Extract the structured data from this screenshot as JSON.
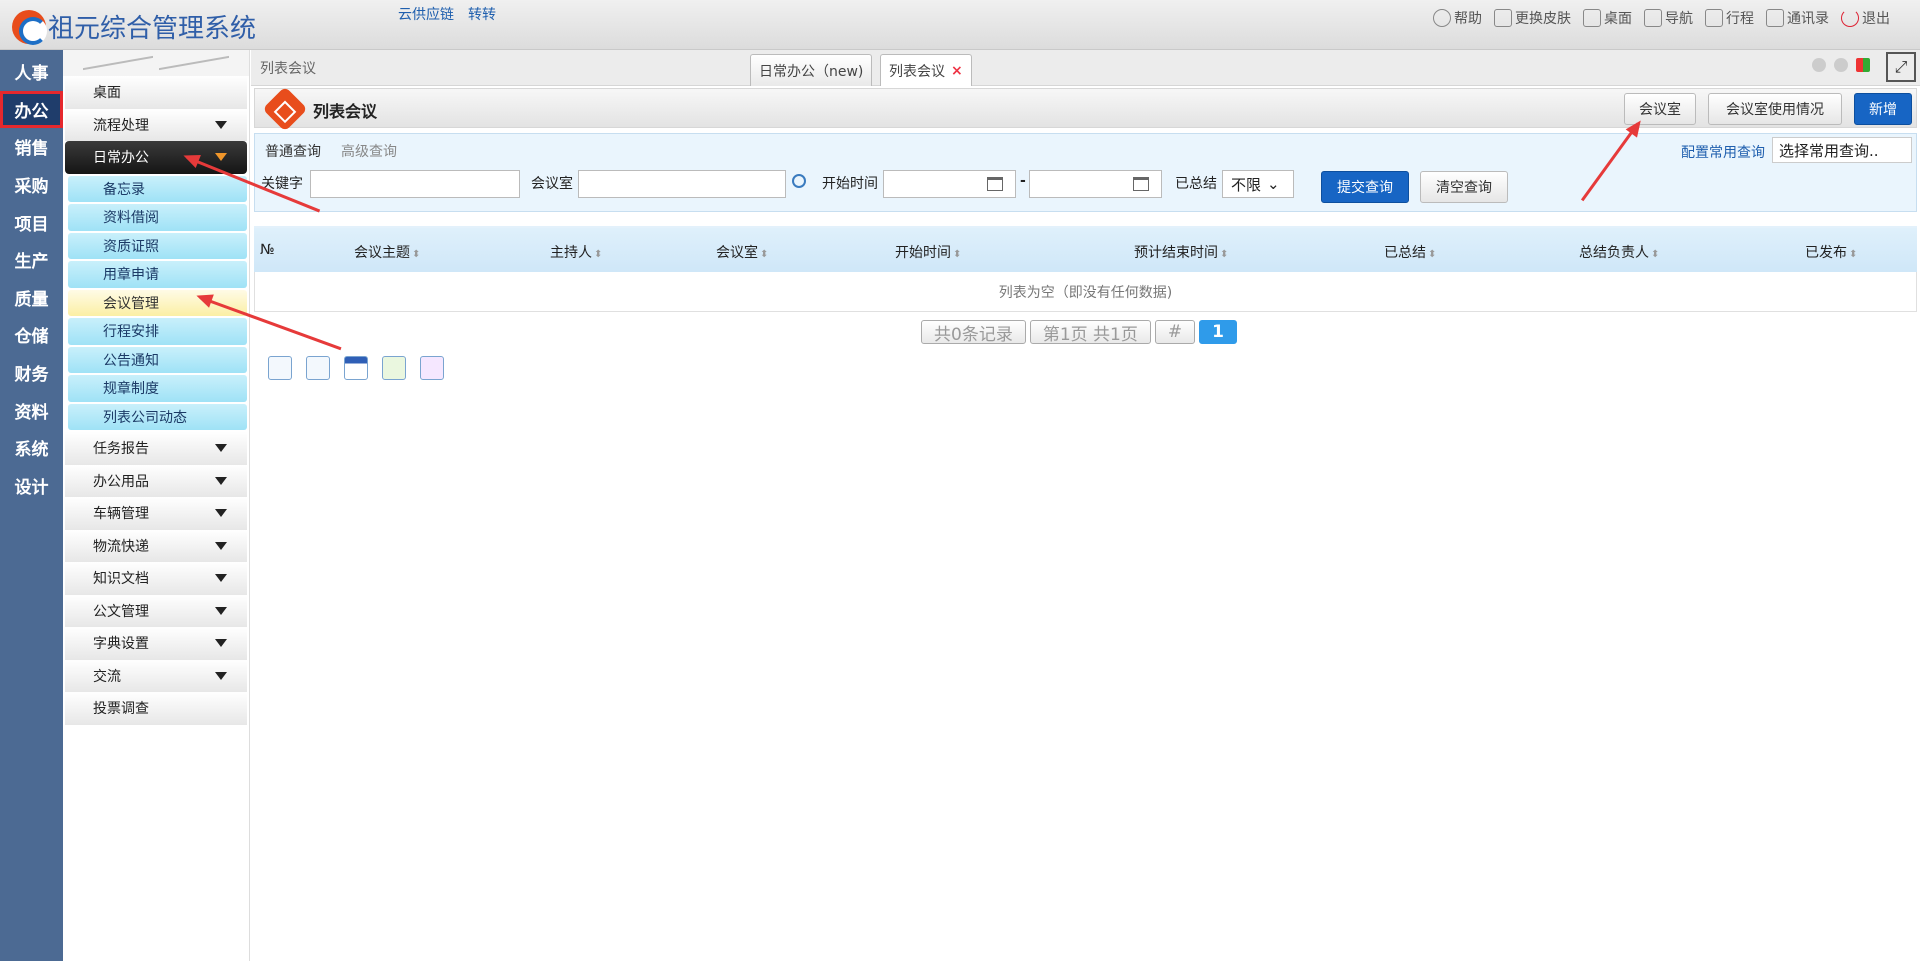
{
  "app": {
    "title": "祖元综合管理系统"
  },
  "top_links": [
    "云供应链",
    "转转"
  ],
  "top_right": [
    {
      "label": "帮助",
      "icon": "help-icon"
    },
    {
      "label": "更换皮肤",
      "icon": "shirt-icon"
    },
    {
      "label": "桌面",
      "icon": "home-icon"
    },
    {
      "label": "导航",
      "icon": "grid-icon"
    },
    {
      "label": "行程",
      "icon": "calendar-icon"
    },
    {
      "label": "通讯录",
      "icon": "contacts-icon"
    },
    {
      "label": "退出",
      "icon": "power-icon"
    }
  ],
  "left_nav": [
    "人事",
    "办公",
    "销售",
    "采购",
    "项目",
    "生产",
    "质量",
    "仓储",
    "财务",
    "资料",
    "系统",
    "设计"
  ],
  "left_nav_active": "办公",
  "submenu": {
    "top_items": [
      "桌面",
      "流程处理"
    ],
    "open_group": "日常办公",
    "children": [
      "备忘录",
      "资料借阅",
      "资质证照",
      "用章申请",
      "会议管理",
      "行程安排",
      "公告通知",
      "规章制度",
      "列表公司动态"
    ],
    "selected_child": "会议管理",
    "groups": [
      "任务报告",
      "办公用品",
      "车辆管理",
      "物流快递",
      "知识文档",
      "公文管理",
      "字典设置",
      "交流"
    ],
    "last_item": "投票调查"
  },
  "tabbar": {
    "title": "列表会议",
    "tabs": [
      {
        "label": "日常办公（new)"
      },
      {
        "label": "列表会议",
        "close": "×"
      }
    ]
  },
  "header": {
    "title": "列表会议",
    "buttons": {
      "meeting_room": "会议室",
      "room_usage": "会议室使用情况",
      "add": "新增"
    }
  },
  "query": {
    "tab_normal": "普通查询",
    "tab_advanced": "高级查询",
    "config_link": "配置常用查询",
    "common_select": "选择常用查询..",
    "keyword_label": "关键字",
    "room_label": "会议室",
    "start_label": "开始时间",
    "dash": "-",
    "summarized_label": "已总结",
    "summarized_value": "不限",
    "submit": "提交查询",
    "clear": "清空查询"
  },
  "grid": {
    "columns": [
      "№",
      "会议主题",
      "主持人",
      "会议室",
      "开始时间",
      "预计结束时间",
      "已总结",
      "总结负责人",
      "已发布"
    ],
    "empty_text": "列表为空（即没有任何数据)"
  },
  "pager": {
    "total": "共0条记录",
    "page": "第1页 共1页",
    "hash": "#",
    "current": "1"
  },
  "colors": {
    "accent": "#1765c4",
    "nav": "#4c6a93",
    "arrow": "#e63a3a"
  }
}
